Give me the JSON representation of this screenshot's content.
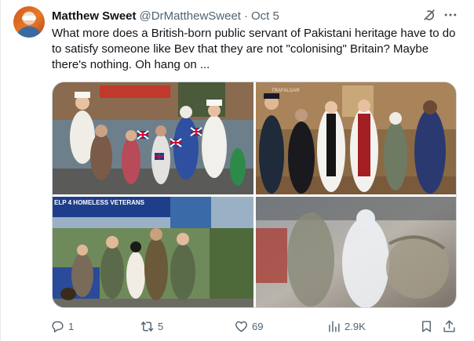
{
  "tweet": {
    "display_name": "Matthew Sweet",
    "handle": "@DrMatthewSweet",
    "separator": "·",
    "time": "Oct 5",
    "text": "What more does a British-born public servant of Pakistani heritage have to do to satisfy someone like Bev that they are not \"colonising\" Britain? Maybe there's nothing. Oh hang on ..."
  },
  "icons": {
    "grok": "grok-icon",
    "more": "more-icon",
    "reply": "reply-icon",
    "retweet": "retweet-icon",
    "like": "heart-icon",
    "views": "views-icon",
    "bookmark": "bookmark-icon",
    "share": "share-icon"
  },
  "media": {
    "photo_2_banner_text": "TRAFALGAR",
    "photo_3_banner_text": "ELP 4 HOMELESS VETERANS"
  },
  "metrics": {
    "replies": "1",
    "retweets": "5",
    "likes": "69",
    "views": "2.9K"
  },
  "colors": {
    "text_primary": "#0f1419",
    "text_secondary": "#536471",
    "border": "#cfd9de"
  }
}
